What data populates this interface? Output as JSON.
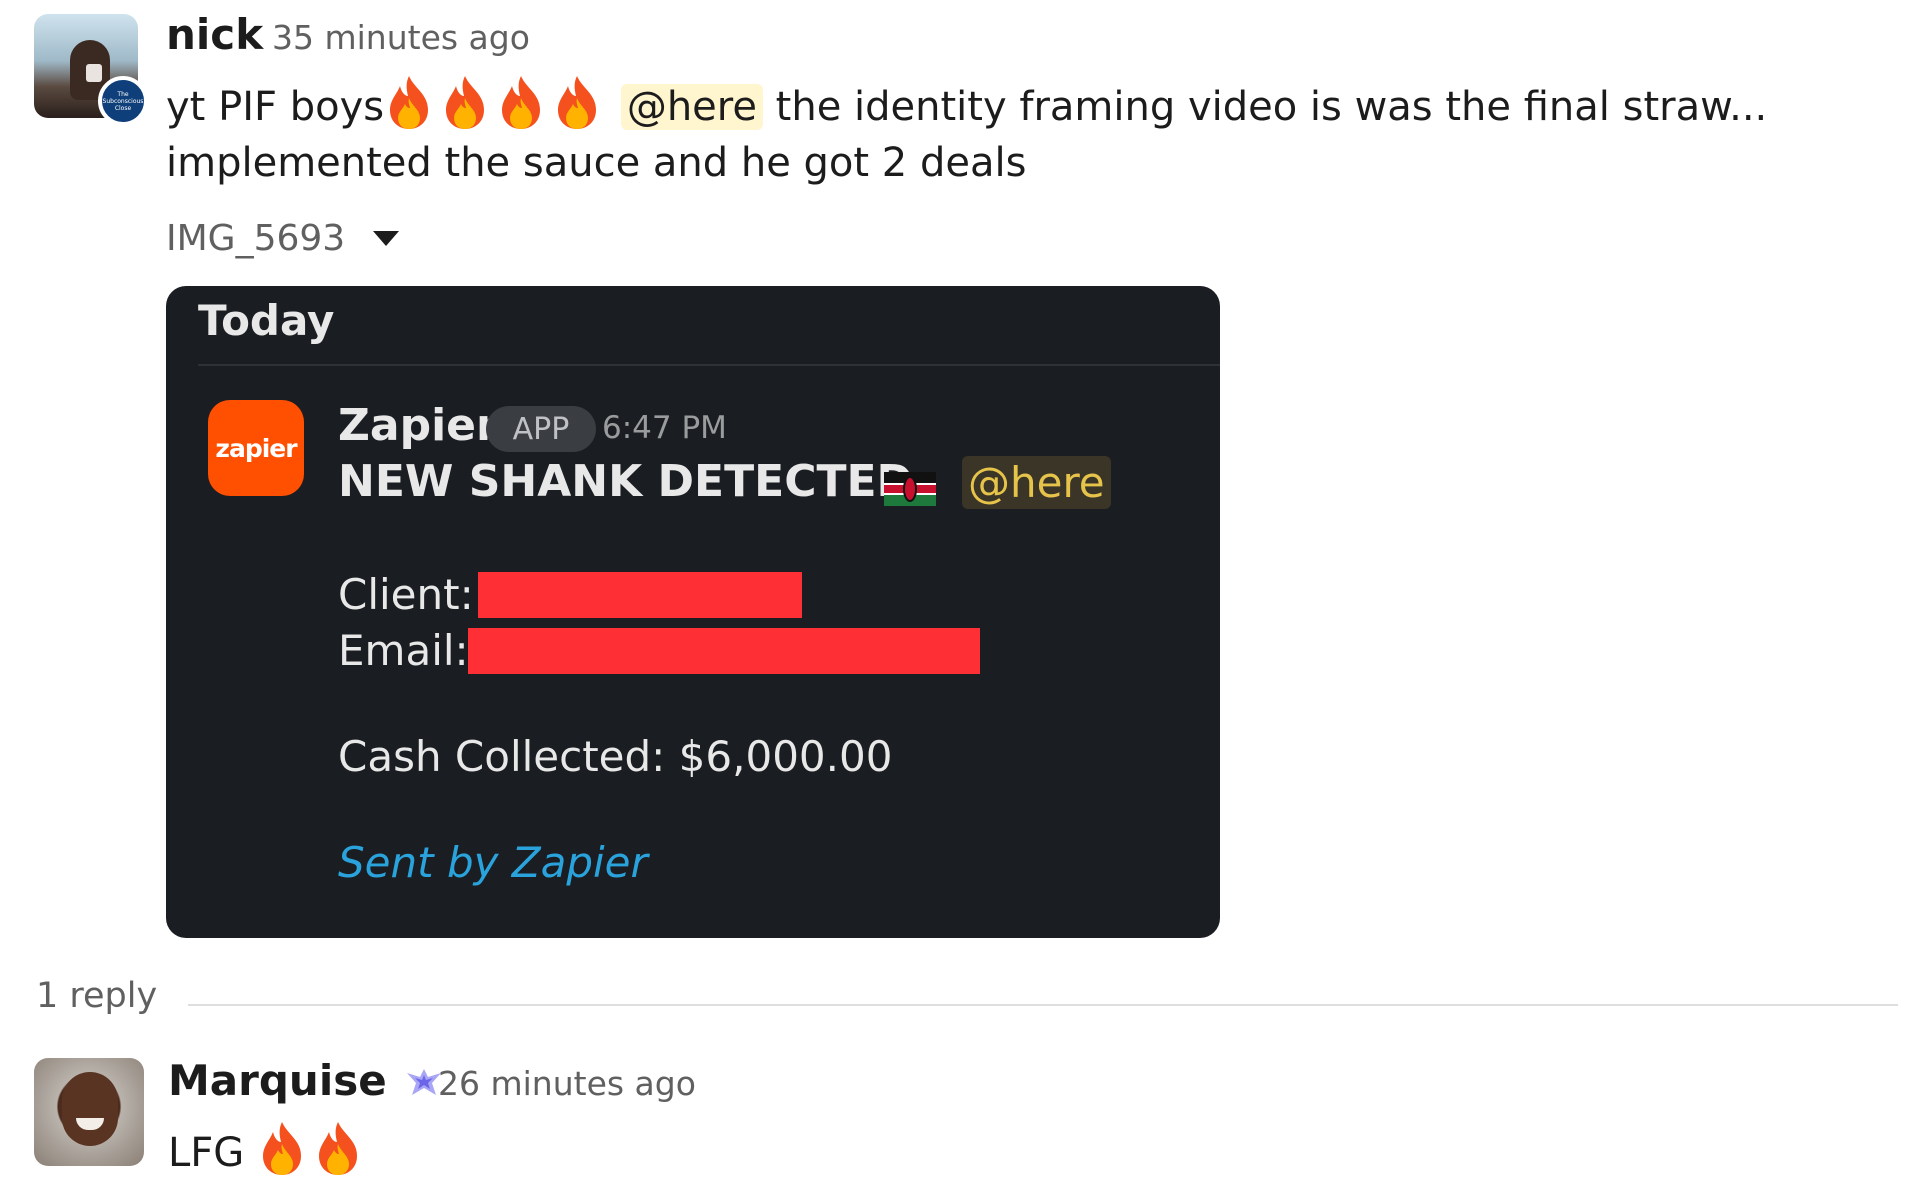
{
  "message": {
    "author": "nick",
    "time": "35 minutes ago",
    "avatar_icon": "user-avatar",
    "badge_text": "The Subconscious Close",
    "line1_prefix": "yt PIF boys",
    "mention": "@here",
    "line1_suffix": "the identity framing video is was the final straw...",
    "line2": "implemented the sauce and he got 2 deals",
    "emoji": "fire",
    "fire_count": 4
  },
  "attachment": {
    "filename": "IMG_5693",
    "toggle_icon": "caret-down-icon",
    "card": {
      "header": "Today",
      "app_logo_text": "zapier",
      "app_name": "Zapier",
      "app_badge": "APP",
      "time": "6:47 PM",
      "headline": "NEW SHANK DETECTED",
      "flag": "kenya-flag-icon",
      "mention": "@here",
      "client_label": "Client:",
      "email_label": "Email:",
      "cash_label": "Cash Collected: $6,000.00",
      "footer": "Sent by Zapier",
      "colors": {
        "background": "#1a1d21",
        "redaction": "#ff2f36",
        "link": "#2aa3dd",
        "brand": "#ff4f00"
      }
    }
  },
  "thread": {
    "reply_count": "1 reply"
  },
  "reply": {
    "author": "Marquise",
    "verified_icon": "verified-icon",
    "time": "26 minutes ago",
    "text": "LFG",
    "fire_count": 2
  }
}
